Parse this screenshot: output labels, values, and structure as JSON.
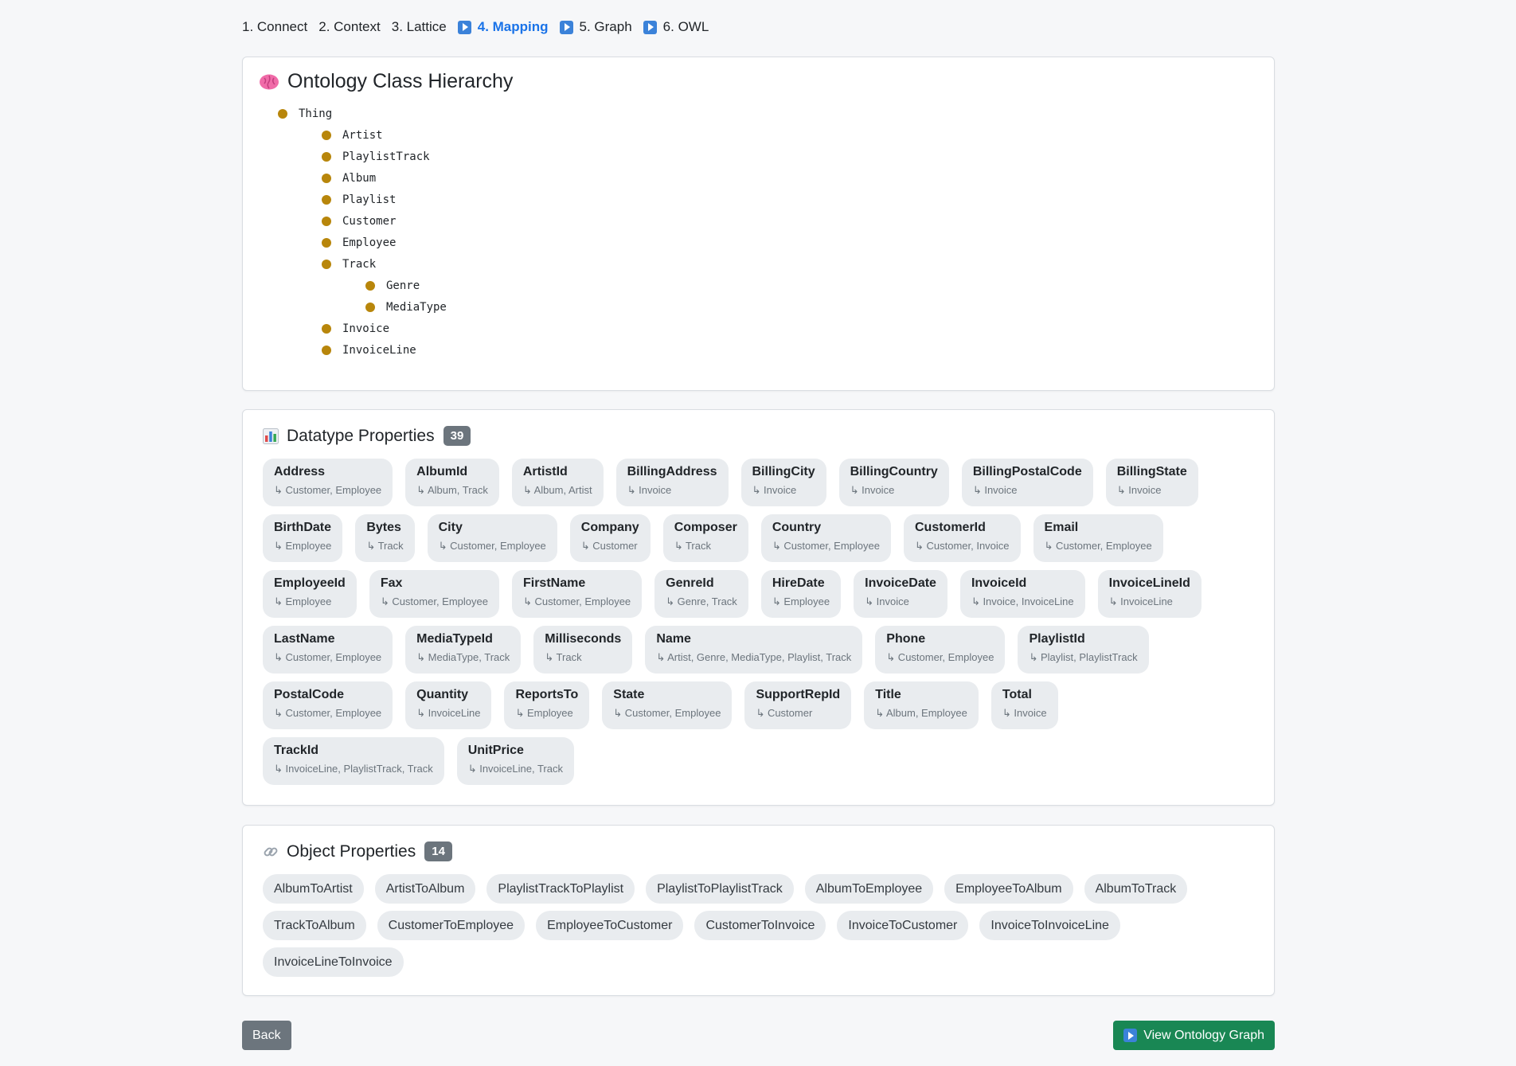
{
  "stepper": [
    {
      "label": "1. Connect",
      "icon": null,
      "active": false
    },
    {
      "label": "2. Context",
      "icon": null,
      "active": false
    },
    {
      "label": "3. Lattice",
      "icon": null,
      "active": false
    },
    {
      "label": "4. Mapping",
      "icon": "play-icon",
      "active": true
    },
    {
      "label": "5. Graph",
      "icon": "play-icon",
      "active": false
    },
    {
      "label": "6. OWL",
      "icon": "play-icon",
      "active": false
    }
  ],
  "hierarchy": {
    "title": "Ontology Class Hierarchy",
    "icon": "brain-icon",
    "nodes": [
      {
        "label": "Thing",
        "level": 0
      },
      {
        "label": "Artist",
        "level": 1
      },
      {
        "label": "PlaylistTrack",
        "level": 1
      },
      {
        "label": "Album",
        "level": 1
      },
      {
        "label": "Playlist",
        "level": 1
      },
      {
        "label": "Customer",
        "level": 1
      },
      {
        "label": "Employee",
        "level": 1
      },
      {
        "label": "Track",
        "level": 1
      },
      {
        "label": "Genre",
        "level": 2
      },
      {
        "label": "MediaType",
        "level": 2
      },
      {
        "label": "Invoice",
        "level": 1
      },
      {
        "label": "InvoiceLine",
        "level": 1
      }
    ]
  },
  "datatype": {
    "title": "Datatype Properties",
    "icon": "bar-chart-icon",
    "count": "39",
    "items": [
      {
        "name": "Address",
        "domains": "↳ Customer, Employee"
      },
      {
        "name": "AlbumId",
        "domains": "↳ Album, Track"
      },
      {
        "name": "ArtistId",
        "domains": "↳ Album, Artist"
      },
      {
        "name": "BillingAddress",
        "domains": "↳ Invoice"
      },
      {
        "name": "BillingCity",
        "domains": "↳ Invoice"
      },
      {
        "name": "BillingCountry",
        "domains": "↳ Invoice"
      },
      {
        "name": "BillingPostalCode",
        "domains": "↳ Invoice"
      },
      {
        "name": "BillingState",
        "domains": "↳ Invoice"
      },
      {
        "name": "BirthDate",
        "domains": "↳ Employee"
      },
      {
        "name": "Bytes",
        "domains": "↳ Track"
      },
      {
        "name": "City",
        "domains": "↳ Customer, Employee"
      },
      {
        "name": "Company",
        "domains": "↳ Customer"
      },
      {
        "name": "Composer",
        "domains": "↳ Track"
      },
      {
        "name": "Country",
        "domains": "↳ Customer, Employee"
      },
      {
        "name": "CustomerId",
        "domains": "↳ Customer, Invoice"
      },
      {
        "name": "Email",
        "domains": "↳ Customer, Employee"
      },
      {
        "name": "EmployeeId",
        "domains": "↳ Employee"
      },
      {
        "name": "Fax",
        "domains": "↳ Customer, Employee"
      },
      {
        "name": "FirstName",
        "domains": "↳ Customer, Employee"
      },
      {
        "name": "GenreId",
        "domains": "↳ Genre, Track"
      },
      {
        "name": "HireDate",
        "domains": "↳ Employee"
      },
      {
        "name": "InvoiceDate",
        "domains": "↳ Invoice"
      },
      {
        "name": "InvoiceId",
        "domains": "↳ Invoice, InvoiceLine"
      },
      {
        "name": "InvoiceLineId",
        "domains": "↳ InvoiceLine"
      },
      {
        "name": "LastName",
        "domains": "↳ Customer, Employee"
      },
      {
        "name": "MediaTypeId",
        "domains": "↳ MediaType, Track"
      },
      {
        "name": "Milliseconds",
        "domains": "↳ Track"
      },
      {
        "name": "Name",
        "domains": "↳ Artist, Genre, MediaType, Playlist, Track"
      },
      {
        "name": "Phone",
        "domains": "↳ Customer, Employee"
      },
      {
        "name": "PlaylistId",
        "domains": "↳ Playlist, PlaylistTrack"
      },
      {
        "name": "PostalCode",
        "domains": "↳ Customer, Employee"
      },
      {
        "name": "Quantity",
        "domains": "↳ InvoiceLine"
      },
      {
        "name": "ReportsTo",
        "domains": "↳ Employee"
      },
      {
        "name": "State",
        "domains": "↳ Customer, Employee"
      },
      {
        "name": "SupportRepId",
        "domains": "↳ Customer"
      },
      {
        "name": "Title",
        "domains": "↳ Album, Employee"
      },
      {
        "name": "Total",
        "domains": "↳ Invoice"
      },
      {
        "name": "TrackId",
        "domains": "↳ InvoiceLine, PlaylistTrack, Track"
      },
      {
        "name": "UnitPrice",
        "domains": "↳ InvoiceLine, Track"
      }
    ]
  },
  "object": {
    "title": "Object Properties",
    "icon": "link-icon",
    "count": "14",
    "items": [
      "AlbumToArtist",
      "ArtistToAlbum",
      "PlaylistTrackToPlaylist",
      "PlaylistToPlaylistTrack",
      "AlbumToEmployee",
      "EmployeeToAlbum",
      "AlbumToTrack",
      "TrackToAlbum",
      "CustomerToEmployee",
      "EmployeeToCustomer",
      "CustomerToInvoice",
      "InvoiceToCustomer",
      "InvoiceToInvoiceLine",
      "InvoiceLineToInvoice"
    ]
  },
  "buttons": {
    "back_label": "Back",
    "graph_label": "View Ontology Graph"
  },
  "colors": {
    "active_step": "#1a73e8",
    "tree_dot": "#b8860b",
    "badge": "#6c757d",
    "graph_button": "#198754",
    "back_button": "#6c757d"
  }
}
